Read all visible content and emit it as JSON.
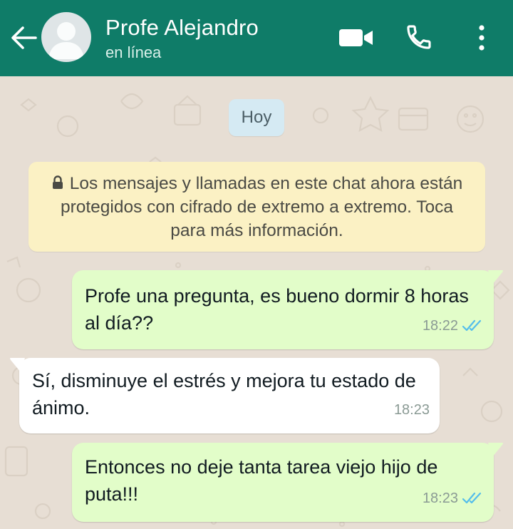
{
  "header": {
    "contact_name": "Profe Alejandro",
    "status": "en línea",
    "colors": {
      "bar": "#0f7c68",
      "text": "#ffffff"
    },
    "icons": [
      "back-arrow-icon",
      "avatar-placeholder-icon",
      "video-call-icon",
      "phone-icon",
      "more-options-icon"
    ]
  },
  "chat": {
    "date_chip": "Hoy",
    "encryption_notice": "Los mensajes y llamadas en este chat ahora están protegidos con cifrado de extremo a extremo. Toca para más información.",
    "messages": [
      {
        "direction": "outgoing",
        "text": "Profe una pregunta, es bueno dormir 8 horas al día??",
        "time": "18:22",
        "read": true
      },
      {
        "direction": "incoming",
        "text": "Sí, disminuye el estrés y mejora tu estado de ánimo.",
        "time": "18:23"
      },
      {
        "direction": "outgoing",
        "text": "Entonces no deje tanta tarea viejo hijo de puta!!!",
        "time": "18:23",
        "read": true
      }
    ],
    "colors": {
      "wallpaper": "#e7ded4",
      "outgoing_bubble": "#e2fdc9",
      "incoming_bubble": "#ffffff",
      "read_ticks": "#53bdeb",
      "notice_bg": "#fbf1c4"
    }
  }
}
